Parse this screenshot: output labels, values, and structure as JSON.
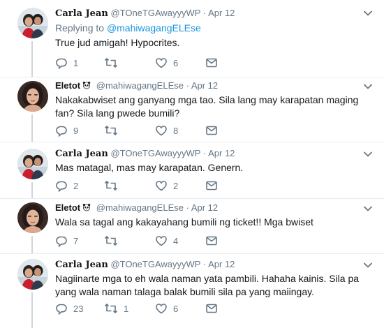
{
  "tweets": [
    {
      "display_name": "Carla Jean",
      "handle": "@TOneTGAwayyyWP",
      "separator": "·",
      "date": "Apr 12",
      "reply_prefix": "Replying to ",
      "reply_handle": "@mahiwagangELEse",
      "text": "True jud amigah! Hypocrites.",
      "replies": "1",
      "retweets": "",
      "likes": "6"
    },
    {
      "display_name": "Eletot",
      "handle": "@mahiwagangELEse",
      "separator": "·",
      "date": "Apr 12",
      "text": "Nakakabwiset ang ganyang mga tao. Sila lang may karapatan maging fan? Sila lang pwede bumili?",
      "replies": "9",
      "retweets": "",
      "likes": "8"
    },
    {
      "display_name": "Carla Jean",
      "handle": "@TOneTGAwayyyWP",
      "separator": "·",
      "date": "Apr 12",
      "text": "Mas matagal, mas may karapatan. Genern.",
      "replies": "2",
      "retweets": "",
      "likes": "2"
    },
    {
      "display_name": "Eletot",
      "handle": "@mahiwagangELEse",
      "separator": "·",
      "date": "Apr 12",
      "text": "Wala sa tagal ang kakayahang bumili ng ticket!! Mga bwiset",
      "replies": "7",
      "retweets": "",
      "likes": "4"
    },
    {
      "display_name": "Carla Jean",
      "handle": "@TOneTGAwayyyWP",
      "separator": "·",
      "date": "Apr 12",
      "text": "Nagiinarte mga to eh wala naman yata pambili. Hahaha kainis. Sila pa yang wala naman talaga balak bumili sila pa yang maiingay.",
      "replies": "23",
      "retweets": "1",
      "likes": "6"
    }
  ],
  "icons": {
    "reply": "reply-icon",
    "retweet": "retweet-icon",
    "like": "heart-icon",
    "dm": "envelope-icon",
    "more": "chevron-down-icon",
    "badge": "panda-emoji-icon"
  },
  "colors": {
    "link": "#1b95e0",
    "muted": "#657786",
    "thread_line": "#ccd6dd",
    "divider": "#e6ecf0"
  }
}
